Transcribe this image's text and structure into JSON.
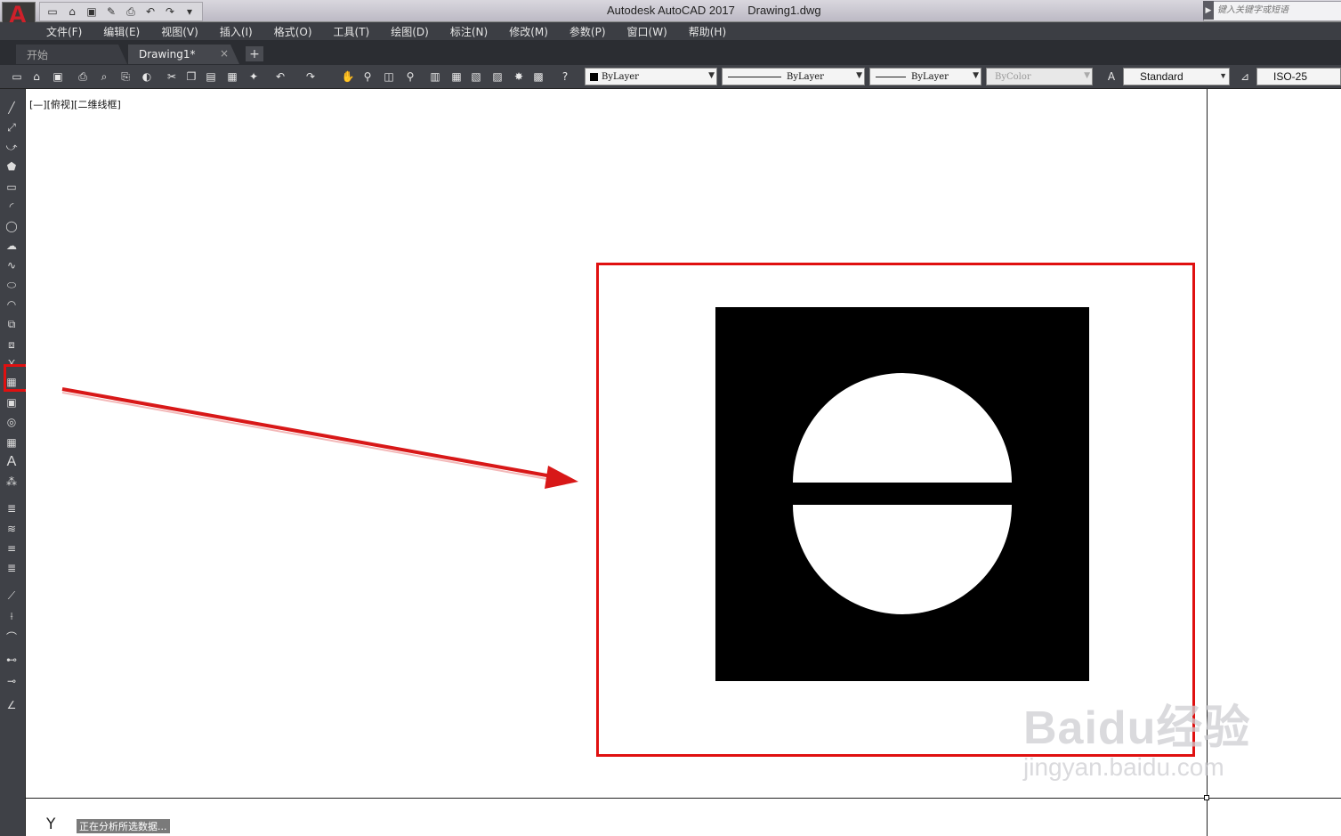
{
  "window": {
    "title": "Autodesk AutoCAD 2017    Drawing1.dwg",
    "logo_letter": "A",
    "search_placeholder": "键入关键字或短语"
  },
  "quick_access": [
    "new-icon",
    "open-icon",
    "save-icon",
    "save-as-icon",
    "plot-icon",
    "undo-icon",
    "redo-icon",
    "customize-icon"
  ],
  "menu": [
    "文件(F)",
    "编辑(E)",
    "视图(V)",
    "插入(I)",
    "格式(O)",
    "工具(T)",
    "绘图(D)",
    "标注(N)",
    "修改(M)",
    "参数(P)",
    "窗口(W)",
    "帮助(H)"
  ],
  "tabs": {
    "start": "开始",
    "drawing": "Drawing1*",
    "close": "×",
    "add": "+"
  },
  "properties": {
    "color": "ByLayer",
    "linetype": "ByLayer",
    "lineweight": "ByLayer",
    "plotstyle": "ByColor",
    "text_style": "Standard",
    "dim_style": "ISO-25"
  },
  "viewport": {
    "label": "[—][俯视][二维线框]"
  },
  "status": {
    "ucs_y": "Y",
    "message": "正在分析所选数据..."
  },
  "watermark": {
    "main": "Baidu经验",
    "sub": "jingyan.baidu.com"
  },
  "colors": {
    "highlight": "#e01010",
    "fill": "#000000"
  }
}
